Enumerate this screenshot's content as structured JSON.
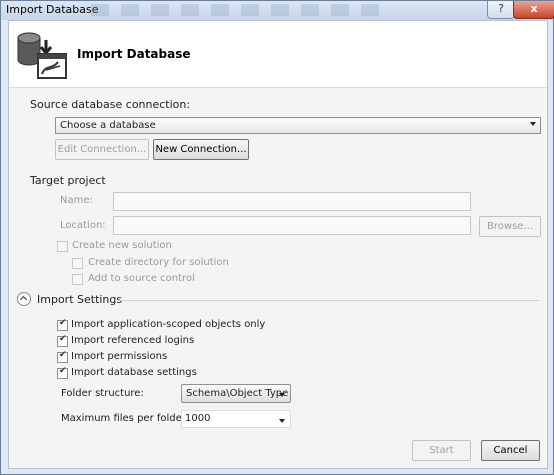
{
  "window": {
    "title": "Import Database",
    "help_label": "?",
    "close_label": "x"
  },
  "header": {
    "title": "Import Database",
    "icon": "database-import-icon"
  },
  "source": {
    "label": "Source database connection:",
    "selected": "Choose a database",
    "edit_button": "Edit Connection...",
    "new_button": "New Connection..."
  },
  "target": {
    "label": "Target project",
    "name_label": "Name:",
    "location_label": "Location:",
    "browse_button": "Browse...",
    "create_solution": "Create new solution",
    "create_directory": "Create directory for solution",
    "add_source_control": "Add to source control"
  },
  "settings": {
    "header": "Import Settings",
    "options": [
      {
        "label": "Import application-scoped objects only",
        "checked": true
      },
      {
        "label": "Import referenced logins",
        "checked": true
      },
      {
        "label": "Import permissions",
        "checked": true
      },
      {
        "label": "Import database settings",
        "checked": true
      }
    ],
    "folder_label": "Folder structure:",
    "folder_value": "Schema\\Object Type",
    "max_files_label": "Maximum files per folder:",
    "max_files_value": "1000"
  },
  "footer": {
    "start_button": "Start",
    "cancel_button": "Cancel"
  }
}
